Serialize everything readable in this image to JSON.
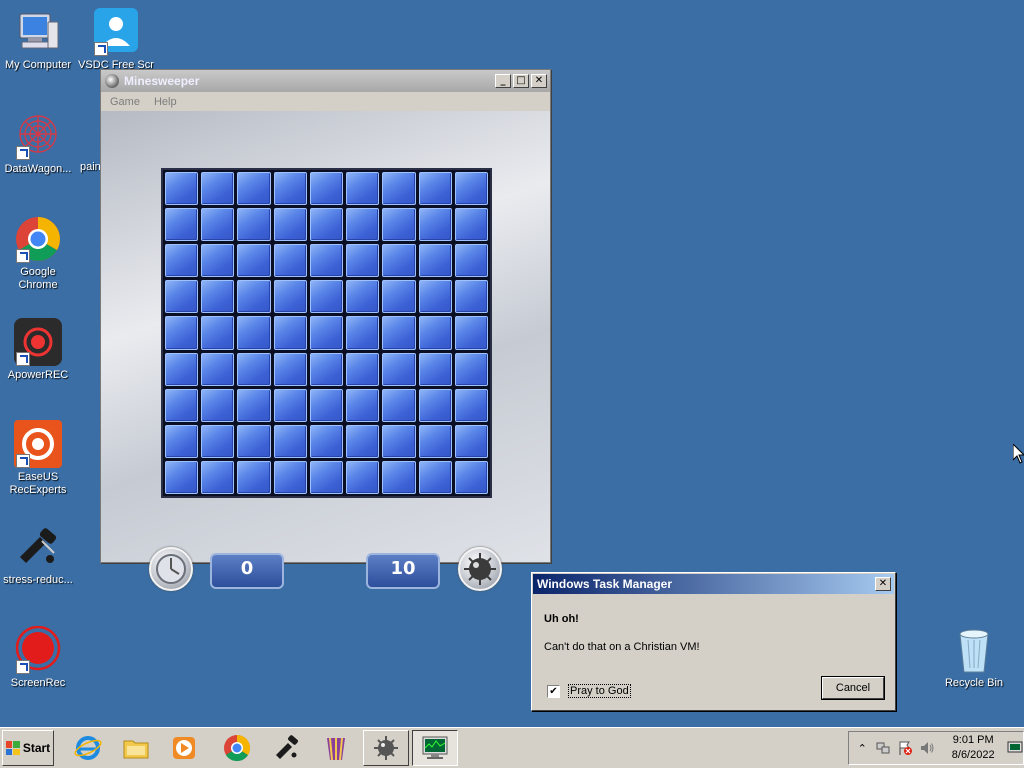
{
  "desktop": {
    "icons": [
      {
        "label": "My Computer"
      },
      {
        "label": "VSDC Free Scr"
      },
      {
        "label": "DataWagon..."
      },
      {
        "label": "pain"
      },
      {
        "label": "Google Chrome"
      },
      {
        "label": "ApowerREC"
      },
      {
        "label": "EaseUS RecExperts"
      },
      {
        "label": "stress-reduc..."
      },
      {
        "label": "ScreenRec"
      },
      {
        "label": "Recycle Bin"
      }
    ]
  },
  "minesweeper": {
    "title": "Minesweeper",
    "menu": [
      "Game",
      "Help"
    ],
    "timer": "0",
    "mines": "10",
    "rows": 9,
    "cols": 9
  },
  "dialog": {
    "title": "Windows Task Manager",
    "heading": "Uh oh!",
    "message": "Can't do that on a Christian VM!",
    "checkbox_label": "Pray to God",
    "checkbox_checked": true,
    "cancel_label": "Cancel"
  },
  "taskbar": {
    "start_label": "Start",
    "apps": [
      "internet-explorer",
      "file-explorer",
      "media-player",
      "google-chrome",
      "stress-reducer",
      "winrar",
      "minesweeper",
      "task-manager"
    ],
    "clock_time": "9:01 PM",
    "clock_date": "8/6/2022"
  },
  "colors": {
    "desktop": "#3a6ea5",
    "dialog_title": "#0a246a",
    "tile": "#4a74e0"
  }
}
